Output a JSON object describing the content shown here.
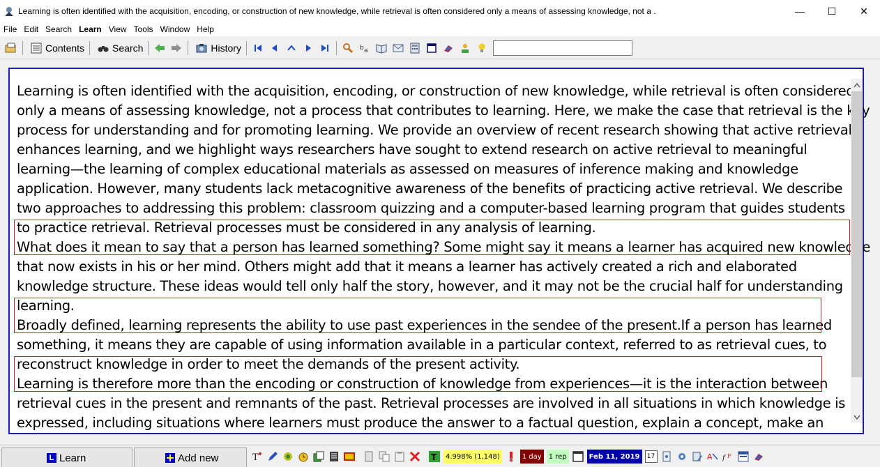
{
  "window": {
    "title": "Learning is often identified with the acquisition, encoding, or construction of new knowledge, while retrieval is often considered only a means of assessing knowledge, not a .",
    "minimize": "—",
    "maximize": "☐",
    "close": "✕"
  },
  "menu": [
    "File",
    "Edit",
    "Search",
    "Learn",
    "View",
    "Tools",
    "Window",
    "Help"
  ],
  "toolbar": {
    "contents_label": "Contents",
    "search_label": "Search",
    "history_label": "History",
    "search_value": ""
  },
  "content": {
    "lines": [
      "Learning is often identified with the acquisition, encoding, or construction of new knowledge, while retrieval is often considered",
      "only a means of assessing knowledge, not a process that contributes to learning. Here, we make the case that retrieval is the key",
      "process for understanding and for promoting learning. We provide an overview of recent research showing that active retrieval",
      "enhances learning, and we highlight ways researchers have sought to extend research on active retrieval to meaningful",
      "learning—the learning of complex educational materials as assessed on measures of inference making and knowledge",
      "application. However, many students lack metacognitive awareness of the benefits of practicing active retrieval. We describe",
      "two approaches to addressing this problem: classroom quizzing and a computer-based learning program that guides students",
      "to practice retrieval. Retrieval processes must be considered in any analysis of learning.",
      "What does it mean to say that a person has learned something? Some might say it means a learner has acquired new knowledge",
      "that now exists in his or her mind. Others might add that it means a learner has actively created a rich and elaborated",
      "knowledge structure. These ideas would tell only half the story, however, and it may not be the crucial half for understanding",
      "learning.",
      "Broadly defined, learning represents the ability to use past experiences in the sendee of the present.If a person has learned",
      "something, it means they are capable of using information available in a particular context, referred to as retrieval cues, to",
      "reconstruct knowledge in order to meet the demands of the present activity.",
      "Learning is therefore more than the encoding or construction of knowledge from experiences—it is the interaction between",
      "retrieval cues in the present and remnants of the past. Retrieval processes are involved in all situations in which knowledge is",
      "expressed, including situations where learners must produce the answer to a factual question, explain a concept, make an"
    ]
  },
  "statusbar": {
    "learn_tab": "Learn",
    "learn_badge": "L",
    "addnew_tab": "Add new",
    "percent": "4.998% (1,148)",
    "interval": "1 day",
    "reps": "1 rep",
    "date": "Feb 11, 2019",
    "calendar_day": "17"
  },
  "colors": {
    "frame_border": "#1a1acc",
    "highlight_border": "#cc2222",
    "percent_bg": "#ffff66",
    "interval_bg": "#800000",
    "reps_bg": "#c0ffc0",
    "date_bg": "#0000aa"
  }
}
